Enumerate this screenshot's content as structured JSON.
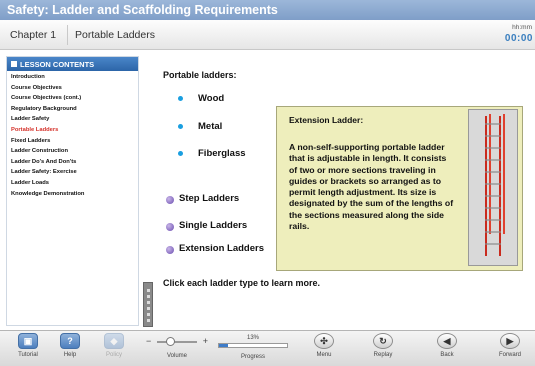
{
  "header": {
    "title": "Safety: Ladder and Scaffolding Requirements"
  },
  "chapter_bar": {
    "chapter": "Chapter 1",
    "lesson": "Portable Ladders",
    "time_format": "hh:mm",
    "time": "00:00"
  },
  "sidebar": {
    "title": "LESSON CONTENTS",
    "items": [
      {
        "label": "Introduction"
      },
      {
        "label": "Course Objectives"
      },
      {
        "label": "Course Objectives (cont.)"
      },
      {
        "label": "Regulatory Background"
      },
      {
        "label": "Ladder Safety"
      },
      {
        "label": "Portable Ladders"
      },
      {
        "label": "Fixed Ladders"
      },
      {
        "label": "Ladder Construction"
      },
      {
        "label": "Ladder Do's And Don'ts"
      },
      {
        "label": "Ladder Safety: Exercise"
      },
      {
        "label": "Ladder Loads"
      },
      {
        "label": "Knowledge Demonstration"
      }
    ],
    "active_index": 5
  },
  "content": {
    "heading": "Portable ladders:",
    "materials": [
      "Wood",
      "Metal",
      "Fiberglass"
    ],
    "ladder_types": [
      "Step Ladders",
      "Single Ladders",
      "Extension Ladders"
    ],
    "hint": "Click each ladder type to learn more.",
    "callout": {
      "title": "Extension Ladder:",
      "body": "A non-self-supporting portable ladder that is adjustable in length. It consists of two or more sections traveling in guides or brackets so arranged as to permit length adjustment. Its size is designated by the sum of the lengths of the sections measured along the side rails."
    }
  },
  "toolbar": {
    "tutorial": "Tutorial",
    "help": "Help",
    "policy": "Policy",
    "volume": "Volume",
    "progress_label": "Progress",
    "progress_value": "13%",
    "progress_fraction": 0.13,
    "menu": "Menu",
    "replay": "Replay",
    "back": "Back",
    "forward": "Forward"
  },
  "colors": {
    "title_bar": "#8ba9d1",
    "sidebar_header": "#2c65a8",
    "active_item": "#d5312a",
    "bullet": "#1a9fe0",
    "callout_bg": "#eeeebc",
    "timer": "#3a7fbf"
  }
}
